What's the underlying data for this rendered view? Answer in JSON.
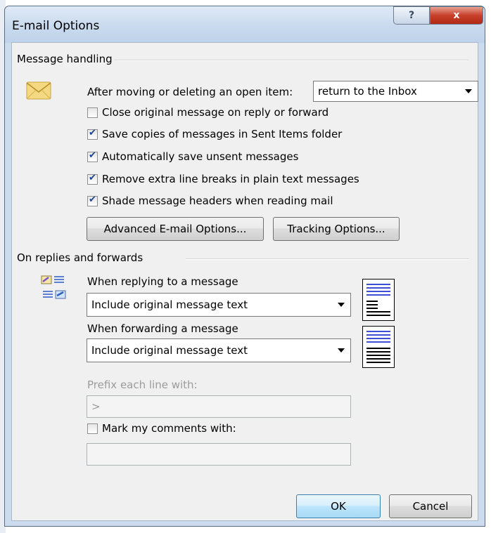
{
  "window": {
    "title": "E-mail Options"
  },
  "caption": {
    "help_glyph": "?",
    "close_glyph": "x"
  },
  "message_handling": {
    "section_label": "Message handling",
    "after_moving_label": "After moving or deleting an open item:",
    "after_moving_value": "return to the Inbox",
    "options": [
      {
        "label": "Close original message on reply or forward",
        "checked": false
      },
      {
        "label": "Save copies of messages in Sent Items folder",
        "checked": true
      },
      {
        "label": "Automatically save unsent messages",
        "checked": true
      },
      {
        "label": "Remove extra line breaks in plain text messages",
        "checked": true
      },
      {
        "label": "Shade message headers when reading mail",
        "checked": true
      }
    ],
    "advanced_button": "Advanced E-mail Options...",
    "tracking_button": "Tracking Options..."
  },
  "replies": {
    "section_label": "On replies and forwards",
    "reply_label": "When replying to a message",
    "reply_value": "Include original message text",
    "forward_label": "When forwarding a message",
    "forward_value": "Include original message text",
    "prefix_label": "Prefix each line with:",
    "prefix_value": ">",
    "mark_comments_label": "Mark my comments with:",
    "mark_comments_checked": false,
    "mark_comments_value": ""
  },
  "footer": {
    "ok": "OK",
    "cancel": "Cancel"
  },
  "icons": {
    "envelope": "envelope-icon",
    "reply_forward": "reply-forward-icon",
    "preview": "message-preview-icon"
  },
  "colors": {
    "accent_blue": "#3c4fd6",
    "dialog_bg": "#f0f0f0",
    "frame": "#cbdcef",
    "close_red": "#c7402a"
  }
}
